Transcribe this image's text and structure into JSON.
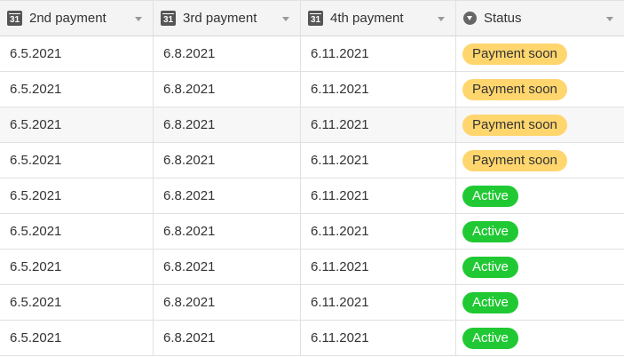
{
  "columns": [
    {
      "label": "2nd payment",
      "icon": "calendar-icon",
      "icon_text": "31"
    },
    {
      "label": "3rd payment",
      "icon": "calendar-icon",
      "icon_text": "31"
    },
    {
      "label": "4th payment",
      "icon": "calendar-icon",
      "icon_text": "31"
    },
    {
      "label": "Status",
      "icon": "single-select-icon"
    }
  ],
  "rows": [
    {
      "second": "6.5.2021",
      "third": "6.8.2021",
      "fourth": "6.11.2021",
      "status": "Payment soon"
    },
    {
      "second": "6.5.2021",
      "third": "6.8.2021",
      "fourth": "6.11.2021",
      "status": "Payment soon"
    },
    {
      "second": "6.5.2021",
      "third": "6.8.2021",
      "fourth": "6.11.2021",
      "status": "Payment soon"
    },
    {
      "second": "6.5.2021",
      "third": "6.8.2021",
      "fourth": "6.11.2021",
      "status": "Payment soon"
    },
    {
      "second": "6.5.2021",
      "third": "6.8.2021",
      "fourth": "6.11.2021",
      "status": "Active"
    },
    {
      "second": "6.5.2021",
      "third": "6.8.2021",
      "fourth": "6.11.2021",
      "status": "Active"
    },
    {
      "second": "6.5.2021",
      "third": "6.8.2021",
      "fourth": "6.11.2021",
      "status": "Active"
    },
    {
      "second": "6.5.2021",
      "third": "6.8.2021",
      "fourth": "6.11.2021",
      "status": "Active"
    },
    {
      "second": "6.5.2021",
      "third": "6.8.2021",
      "fourth": "6.11.2021",
      "status": "Active"
    }
  ],
  "colors": {
    "payment_soon": "#ffd66e",
    "active": "#20c933",
    "header_bg": "#f4f4f4",
    "hover_row_bg": "#f7f7f7"
  }
}
